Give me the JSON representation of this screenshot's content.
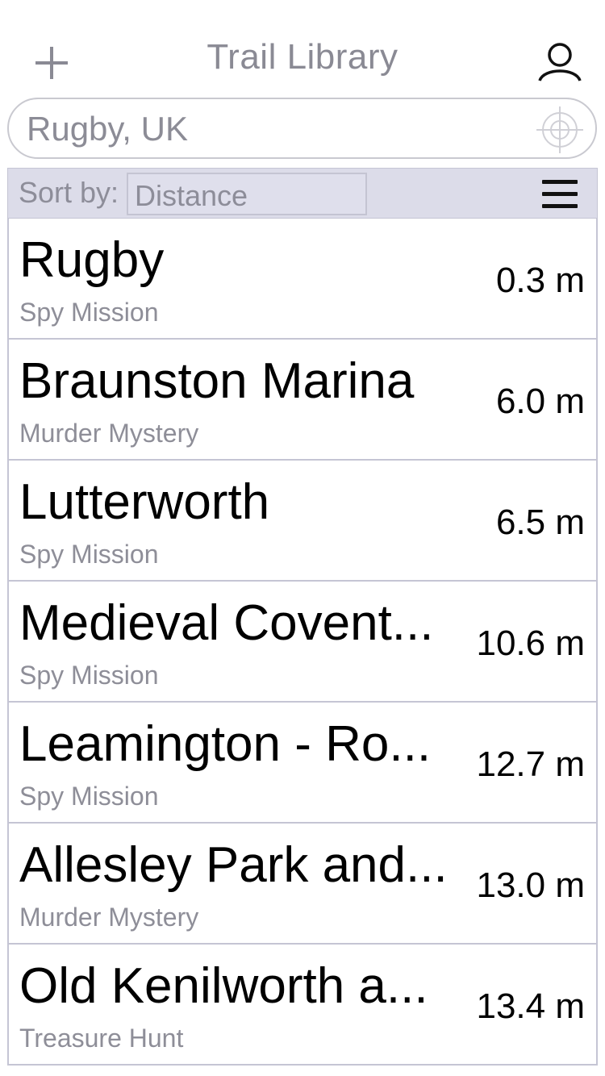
{
  "header": {
    "title": "Trail Library",
    "add_icon": "plus-icon",
    "profile_icon": "user-icon"
  },
  "search": {
    "value": "Rugby, UK",
    "placeholder": "Rugby, UK",
    "locate_icon": "crosshair-icon"
  },
  "sort": {
    "label": "Sort by:",
    "selected": "Distance",
    "menu_icon": "hamburger-menu-icon"
  },
  "trails": [
    {
      "name": "Rugby",
      "type": "Spy Mission",
      "distance": "0.3 m"
    },
    {
      "name": "Braunston Marina",
      "type": "Murder Mystery",
      "distance": "6.0 m"
    },
    {
      "name": "Lutterworth",
      "type": "Spy Mission",
      "distance": "6.5 m"
    },
    {
      "name": "Medieval Covent...",
      "type": "Spy Mission",
      "distance": "10.6 m"
    },
    {
      "name": "Leamington - Ro...",
      "type": "Spy Mission",
      "distance": "12.7 m"
    },
    {
      "name": "Allesley Park and...",
      "type": "Murder Mystery",
      "distance": "13.0 m"
    },
    {
      "name": "Old Kenilworth a...",
      "type": "Treasure Hunt",
      "distance": "13.4 m"
    }
  ],
  "colors": {
    "title_gray": "#8a8a94",
    "sort_bar_bg": "#dcdce9",
    "border": "#c5c5d4",
    "text_primary": "#000000",
    "text_secondary": "#8e8e98"
  }
}
